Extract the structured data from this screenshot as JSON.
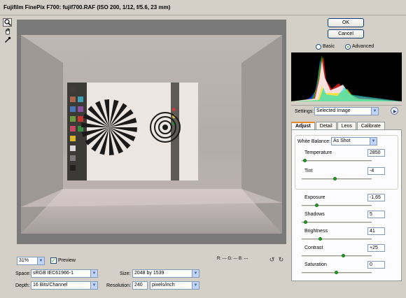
{
  "window": {
    "title": "Fujifilm FinePix F700:  fujif700.RAF  (ISO 200, 1/12, f/5.6, 23 mm)"
  },
  "tools": [
    {
      "name": "zoom-tool-icon"
    },
    {
      "name": "hand-tool-icon"
    },
    {
      "name": "white-balance-eyedropper-icon"
    }
  ],
  "buttons": {
    "ok": "OK",
    "cancel": "Cancel"
  },
  "mode": {
    "basic": "Basic",
    "advanced": "Advanced",
    "selected": "advanced"
  },
  "settings": {
    "label": "Settings:",
    "value": "Selected Image"
  },
  "tabs": [
    "Adjust",
    "Detail",
    "Lens",
    "Calibrate"
  ],
  "adjust": {
    "white_balance_label": "White Balance:",
    "white_balance_value": "As Shot",
    "controls": [
      {
        "label": "Temperature",
        "value": "2850",
        "level": 0.05
      },
      {
        "label": "Tint",
        "value": "-4",
        "level": 0.48
      },
      {
        "label": "Exposure",
        "value": "-1,65",
        "level": 0.22
      },
      {
        "label": "Shadows",
        "value": "5",
        "level": 0.06
      },
      {
        "label": "Brightness",
        "value": "41",
        "level": 0.27
      },
      {
        "label": "Contrast",
        "value": "+25",
        "level": 0.6
      },
      {
        "label": "Saturation",
        "value": "0",
        "level": 0.5
      }
    ]
  },
  "preview": {
    "zoom": "31%",
    "preview_label": "Preview",
    "preview_checked": true
  },
  "readout": "R: ---   G: ---   B: ---",
  "workflow": {
    "space_label": "Space:",
    "space_value": "sRGB IEC61966-1",
    "depth_label": "Depth:",
    "depth_value": "16 Bits/Channel",
    "size_label": "Size:",
    "size_value": "2048 by 1539",
    "resolution_label": "Resolution:",
    "resolution_value": "240",
    "resolution_unit": "pixels/inch"
  },
  "colors": {
    "chrome": "#d4d0c8",
    "well": "#7a7a7a",
    "slider_thumb": "#21a121",
    "tab_accent": "#e68b2c",
    "histogram_bg": "#000000"
  }
}
